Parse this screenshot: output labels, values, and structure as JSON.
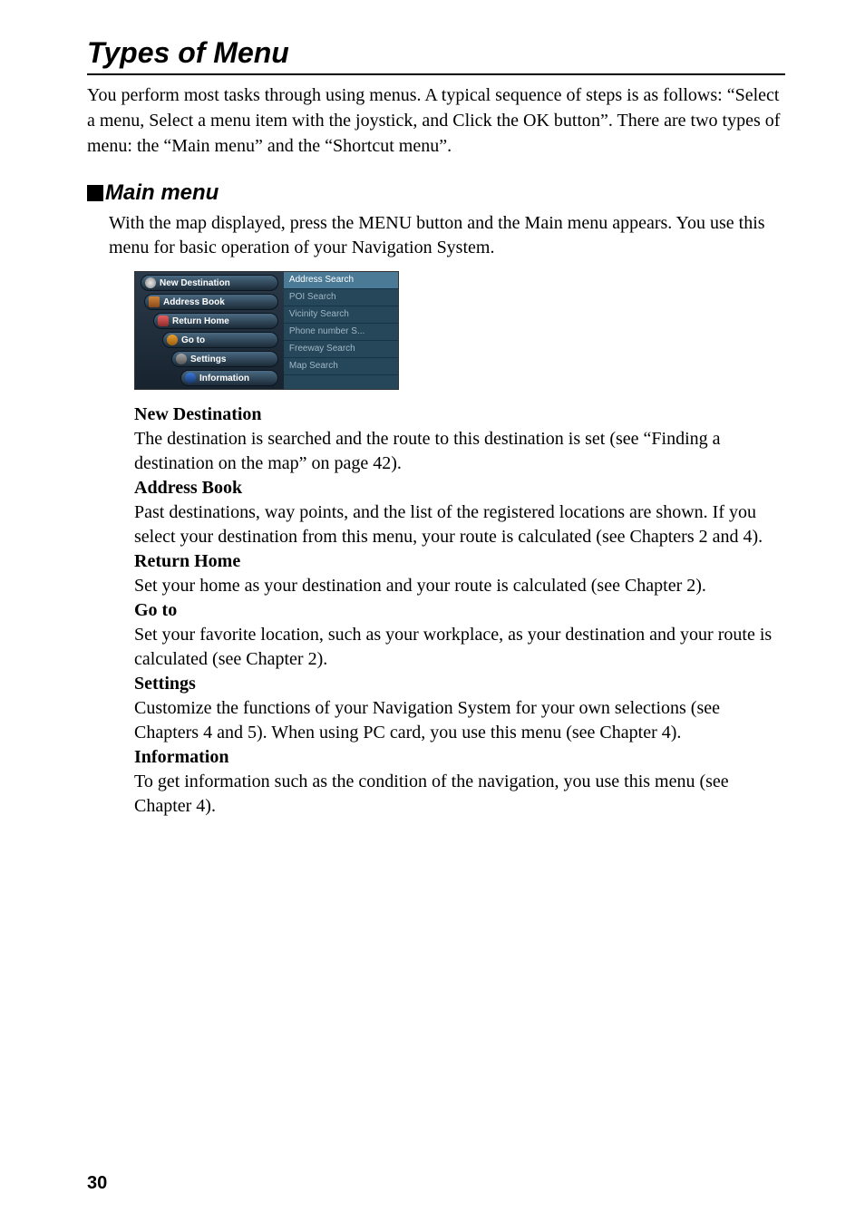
{
  "title": "Types of Menu",
  "intro": "You perform most tasks through using menus. A typical sequence of steps is as follows: “Select a menu, Select a menu item with the joystick, and Click the OK button”. There are two types of menu: the “Main menu” and the “Shortcut menu”.",
  "section_heading": "Main menu",
  "section_text": "With the map displayed, press the MENU button and the Main menu appears. You use this menu for basic operation of your Navigation System.",
  "screenshot": {
    "left_menu": [
      "New Destination",
      "Address Book",
      "Return Home",
      "Go to",
      "Settings",
      "Information"
    ],
    "right_menu": [
      "Address Search",
      "POI Search",
      "Vicinity  Search",
      "Phone number S...",
      "Freeway Search",
      "Map Search"
    ]
  },
  "defs": [
    {
      "t": "New Destination",
      "d": "The destination is searched and the route to this destination is set (see “Finding a destination on the map” on page 42)."
    },
    {
      "t": "Address Book",
      "d": "Past destinations, way points, and the list of the registered locations are shown. If you select your destination from this menu, your route is calculated (see Chapters 2 and 4)."
    },
    {
      "t": "Return Home",
      "d": "Set your home as your destination and your route is calculated (see Chapter 2)."
    },
    {
      "t": "Go to",
      "d": "Set your favorite location, such as your workplace, as your destination and your route is calculated (see Chapter 2)."
    },
    {
      "t": "Settings",
      "d": "Customize the functions of your Navigation System for your own selections (see Chapters 4 and 5). When using PC card, you use this menu (see Chapter 4)."
    },
    {
      "t": "Information",
      "d": "To get information such as the condition of the navigation, you use this menu (see Chapter 4)."
    }
  ],
  "page_number": "30"
}
